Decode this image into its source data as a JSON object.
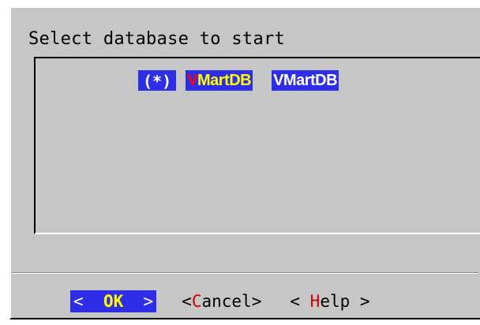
{
  "dialog": {
    "title": "Select database to start"
  },
  "list": {
    "items": [
      {
        "radio": "(*)",
        "tag_hotkey": "V",
        "tag_rest": "MartDB",
        "item": "VMartDB",
        "selected": true
      }
    ]
  },
  "buttons": {
    "ok": {
      "left": "<  ",
      "hotkey": "OK",
      "right": "  >",
      "focused": true
    },
    "cancel": {
      "left": "<",
      "hotkey": "C",
      "rest": "ancel",
      "right": ">"
    },
    "help": {
      "left": "< ",
      "hotkey": "H",
      "rest": "elp",
      "right": " >"
    }
  },
  "colors": {
    "dialog_bg": "#c6c6c6",
    "highlight_bg": "#2e2ee6",
    "hotkey_active": "#ffff00",
    "hotkey": "#cc0000",
    "tag_hotkey": "#ff0000"
  }
}
